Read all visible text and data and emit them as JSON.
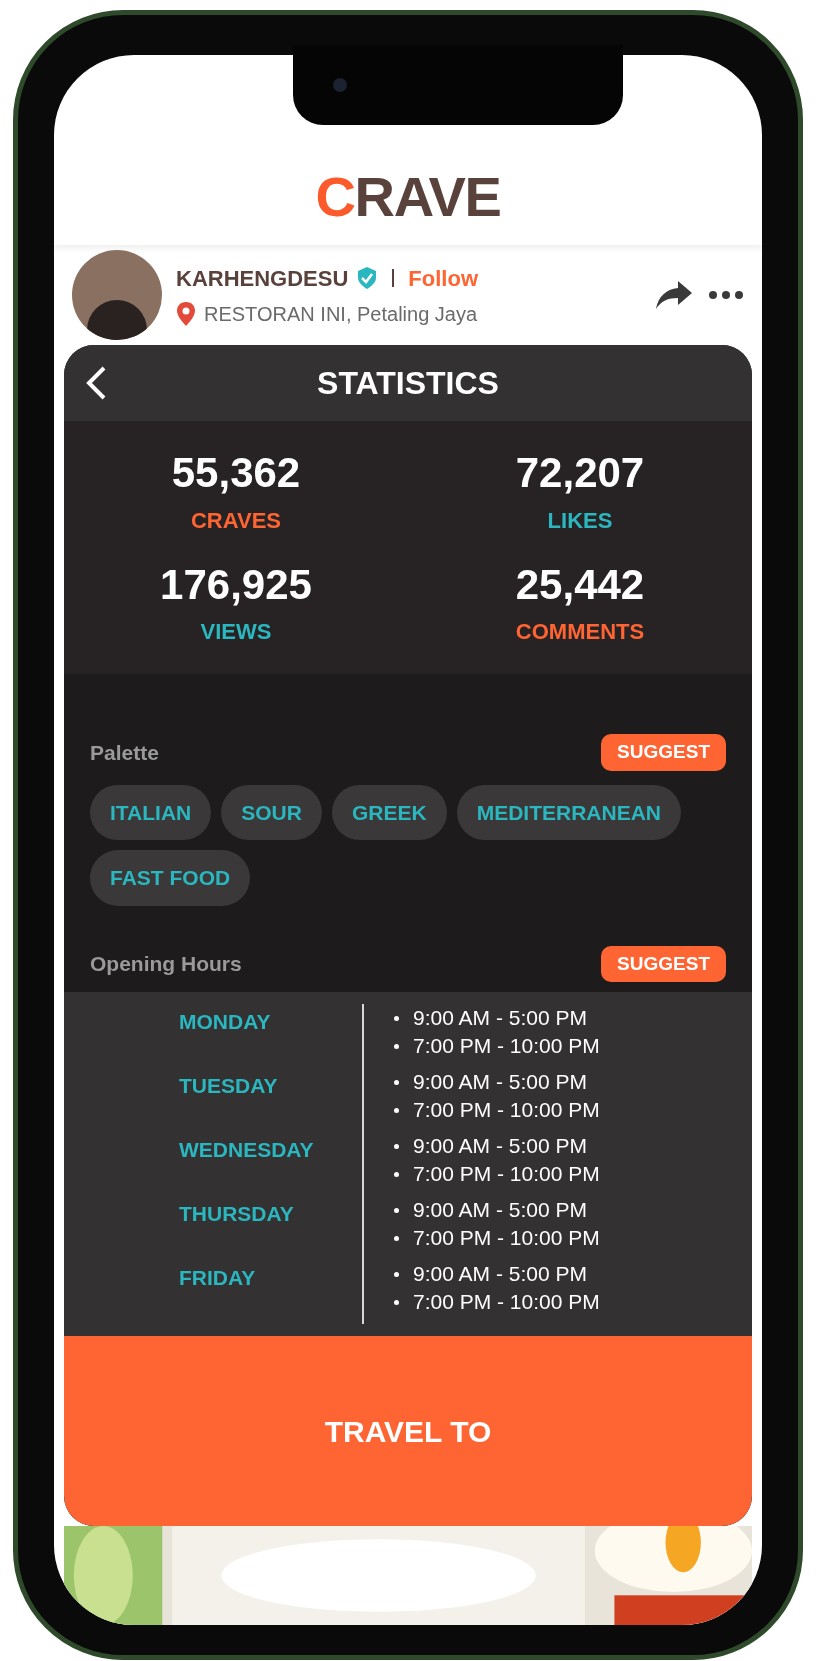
{
  "logo": {
    "accent": "C",
    "rest": "RAVE"
  },
  "post": {
    "username": "KARHENGDESU",
    "verified": true,
    "follow": "Follow",
    "location": "RESTORAN INI, Petaling Jaya"
  },
  "statistics": {
    "title": "STATISTICS",
    "stats": [
      {
        "value": "55,362",
        "label": "CRAVES",
        "color": "#ff6433"
      },
      {
        "value": "72,207",
        "label": "LIKES",
        "color": "#2ab7bf"
      },
      {
        "value": "176,925",
        "label": "VIEWS",
        "color": "#2ab7bf"
      },
      {
        "value": "25,442",
        "label": "COMMENTS",
        "color": "#ff6433"
      }
    ]
  },
  "palette": {
    "title": "Palette",
    "suggest": "SUGGEST",
    "tags": [
      "ITALIAN",
      "SOUR",
      "GREEK",
      "MEDITERRANEAN",
      "FAST FOOD"
    ]
  },
  "opening_hours": {
    "title": "Opening Hours",
    "suggest": "SUGGEST",
    "days": [
      {
        "day": "MONDAY",
        "times": [
          "9:00 AM - 5:00 PM",
          "7:00 PM - 10:00 PM"
        ]
      },
      {
        "day": "TUESDAY",
        "times": [
          "9:00 AM - 5:00 PM",
          "7:00 PM - 10:00 PM"
        ]
      },
      {
        "day": "WEDNESDAY",
        "times": [
          "9:00 AM - 5:00 PM",
          "7:00 PM - 10:00 PM"
        ]
      },
      {
        "day": "THURSDAY",
        "times": [
          "9:00 AM - 5:00 PM",
          "7:00 PM - 10:00 PM"
        ]
      },
      {
        "day": "FRIDAY",
        "times": [
          "9:00 AM - 5:00 PM",
          "7:00 PM - 10:00 PM"
        ]
      }
    ]
  },
  "action": "TRAVEL TO"
}
